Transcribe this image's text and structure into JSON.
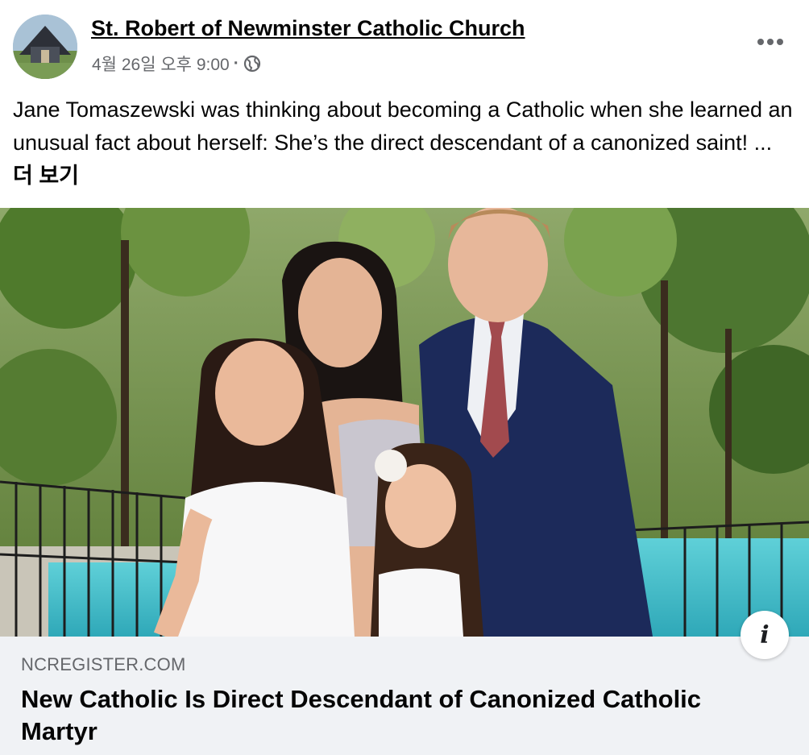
{
  "post": {
    "page_name": "St. Robert of Newminster Catholic Church",
    "timestamp": "4월 26일 오후 9:00",
    "separator": "·",
    "privacy_icon": "globe-icon",
    "more_icon": "more-options-icon",
    "text": "Jane Tomaszewski was thinking about becoming a Catholic when she learned an unusual fact about herself: She’s the direct descendant of a canonized saint! ... ",
    "see_more_label": "더 보기"
  },
  "link": {
    "domain": "NCREGISTER.COM",
    "title": "New Catholic Is Direct Descendant of Canonized Catholic Martyr",
    "info_label": "i"
  },
  "colors": {
    "text_primary": "#050505",
    "text_secondary": "#65676b",
    "card_background": "#f0f2f5"
  }
}
